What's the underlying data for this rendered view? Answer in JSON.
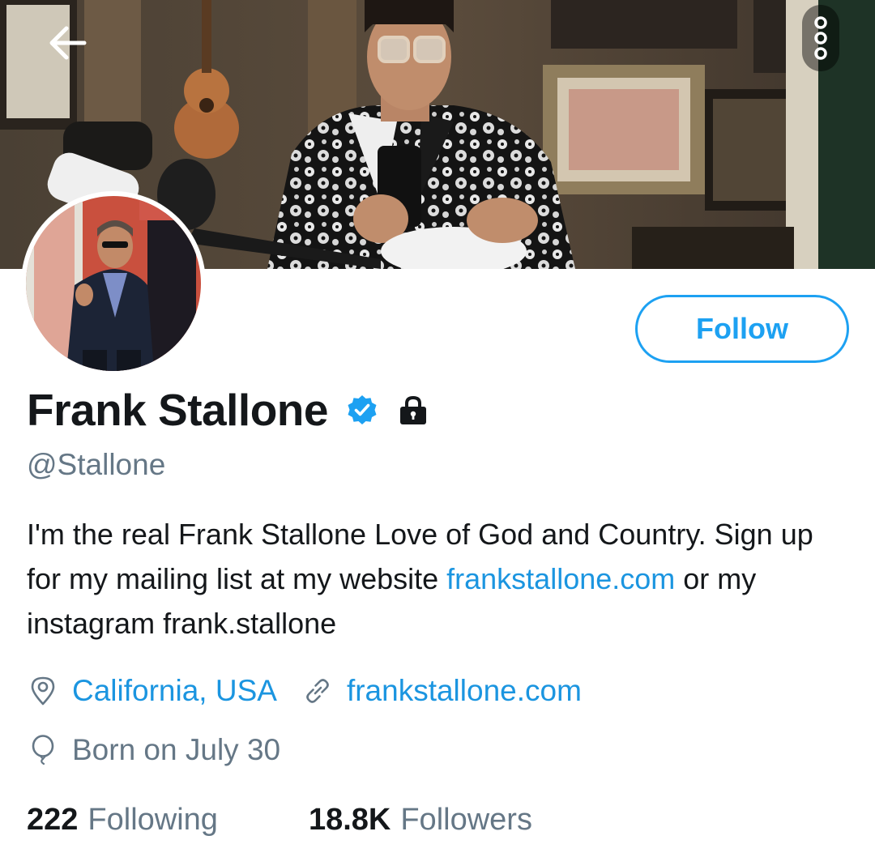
{
  "header": {
    "back_icon": "arrow-left-icon",
    "more_icon": "more-vertical-icon"
  },
  "profile": {
    "display_name": "Frank Stallone",
    "verified_icon": "verified-badge-icon",
    "protected_icon": "lock-icon",
    "handle": "@Stallone",
    "follow_label": "Follow",
    "bio": {
      "text_1": "I'm the real Frank Stallone Love of God and Country. Sign up for my mailing list at my website ",
      "link": "frankstallone.com",
      "text_2": " or my instagram frank.stallone"
    },
    "location": "California, USA",
    "website": "frankstallone.com",
    "birthday": "Born on July 30",
    "following_count": "222",
    "following_label": "Following",
    "followers_count": "18.8K",
    "followers_label": "Followers"
  },
  "colors": {
    "accent": "#1da1f2",
    "link": "#1b95e0",
    "muted": "#657786",
    "text": "#14171a"
  }
}
